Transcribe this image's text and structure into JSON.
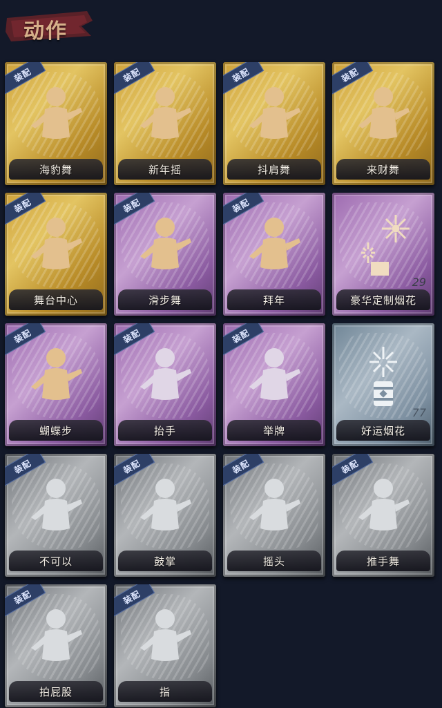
{
  "header": {
    "title": "动作"
  },
  "equip_label": "装配",
  "items": [
    {
      "name": "海豹舞",
      "rarity": "gold",
      "equipped": true,
      "icon": "seal-dance-pose-icon"
    },
    {
      "name": "新年摇",
      "rarity": "gold",
      "equipped": true,
      "icon": "new-year-sway-pose-icon"
    },
    {
      "name": "抖肩舞",
      "rarity": "gold",
      "equipped": true,
      "icon": "shoulder-shake-pose-icon"
    },
    {
      "name": "来财舞",
      "rarity": "gold",
      "equipped": true,
      "icon": "fortune-dance-pose-icon"
    },
    {
      "name": "舞台中心",
      "rarity": "gold",
      "equipped": true,
      "icon": "center-stage-pose-icon"
    },
    {
      "name": "滑步舞",
      "rarity": "purple",
      "equipped": true,
      "icon": "slide-dance-pose-icon"
    },
    {
      "name": "拜年",
      "rarity": "purple",
      "equipped": true,
      "icon": "new-year-greeting-pose-icon"
    },
    {
      "name": "豪华定制烟花",
      "rarity": "purple",
      "equipped": false,
      "icon": "deluxe-fireworks-icon",
      "count": "29"
    },
    {
      "name": "蝴蝶步",
      "rarity": "purple",
      "equipped": true,
      "icon": "butterfly-step-pose-icon"
    },
    {
      "name": "抬手",
      "rarity": "purple",
      "equipped": true,
      "icon": "raise-hand-pose-icon"
    },
    {
      "name": "举牌",
      "rarity": "purple",
      "equipped": true,
      "icon": "hold-sign-pose-icon"
    },
    {
      "name": "好运烟花",
      "rarity": "blue",
      "equipped": false,
      "icon": "lucky-fireworks-icon",
      "count": "77"
    },
    {
      "name": "不可以",
      "rarity": "gray",
      "equipped": true,
      "icon": "no-finger-pose-icon"
    },
    {
      "name": "鼓掌",
      "rarity": "gray",
      "equipped": true,
      "icon": "clap-pose-icon"
    },
    {
      "name": "摇头",
      "rarity": "gray",
      "equipped": true,
      "icon": "shake-head-pose-icon"
    },
    {
      "name": "推手舞",
      "rarity": "gray",
      "equipped": true,
      "icon": "push-hand-dance-pose-icon"
    },
    {
      "name": "拍屁股",
      "rarity": "gray",
      "equipped": true,
      "icon": "pat-butt-pose-icon"
    },
    {
      "name": "指",
      "rarity": "gray",
      "equipped": true,
      "icon": "point-pose-icon"
    }
  ]
}
